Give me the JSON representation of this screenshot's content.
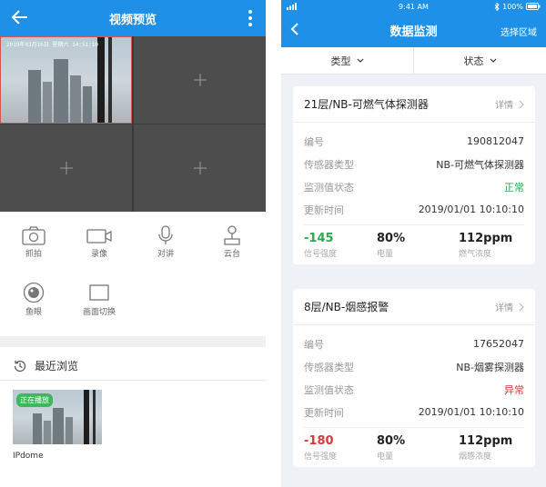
{
  "left": {
    "header": {
      "title": "视频预览"
    },
    "grid": {
      "osd_text": "2019年03月16日 星期六 14:51:10"
    },
    "tools": [
      {
        "label": "抓拍",
        "icon": "camera-icon"
      },
      {
        "label": "录像",
        "icon": "video-camera-icon"
      },
      {
        "label": "对讲",
        "icon": "microphone-icon"
      },
      {
        "label": "云台",
        "icon": "joystick-icon"
      },
      {
        "label": "鱼眼",
        "icon": "fisheye-icon"
      },
      {
        "label": "画面切换",
        "icon": "screen-switch-icon"
      }
    ],
    "recent": {
      "title": "最近浏览",
      "badge": "正在播放",
      "name": "IPdome"
    }
  },
  "right": {
    "statusbar": {
      "time": "9:41 AM",
      "battery": "100%"
    },
    "header": {
      "title": "数据监测",
      "select_label": "选择区域"
    },
    "filters": [
      {
        "label": "类型"
      },
      {
        "label": "状态"
      }
    ],
    "detail_label": "详情",
    "field_labels": {
      "serial": "编号",
      "sensor_type": "传感器类型",
      "status": "监测值状态",
      "updated": "更新时间"
    },
    "cards": [
      {
        "name": "21层/NB-可燃气体探测器",
        "serial": "190812047",
        "sensor_type": "NB-可燃气体探测器",
        "status": "正常",
        "updated": "2019/01/01 10:10:10",
        "signal": "-145",
        "signal_label": "信号强度",
        "battery": "80%",
        "battery_label": "电量",
        "reading": "112ppm",
        "reading_label": "燃气浓度"
      },
      {
        "name": "8层/NB-烟感报警",
        "serial": "17652047",
        "sensor_type": "NB-烟雾探测器",
        "status": "异常",
        "updated": "2019/01/01 10:10:10",
        "signal": "-180",
        "signal_label": "信号强度",
        "battery": "80%",
        "battery_label": "电量",
        "reading": "112ppm",
        "reading_label": "烟感浓度"
      }
    ],
    "colors": {
      "brand": "#1e90e8",
      "ok": "#2ea84a",
      "alarm": "#d83a3a"
    }
  }
}
